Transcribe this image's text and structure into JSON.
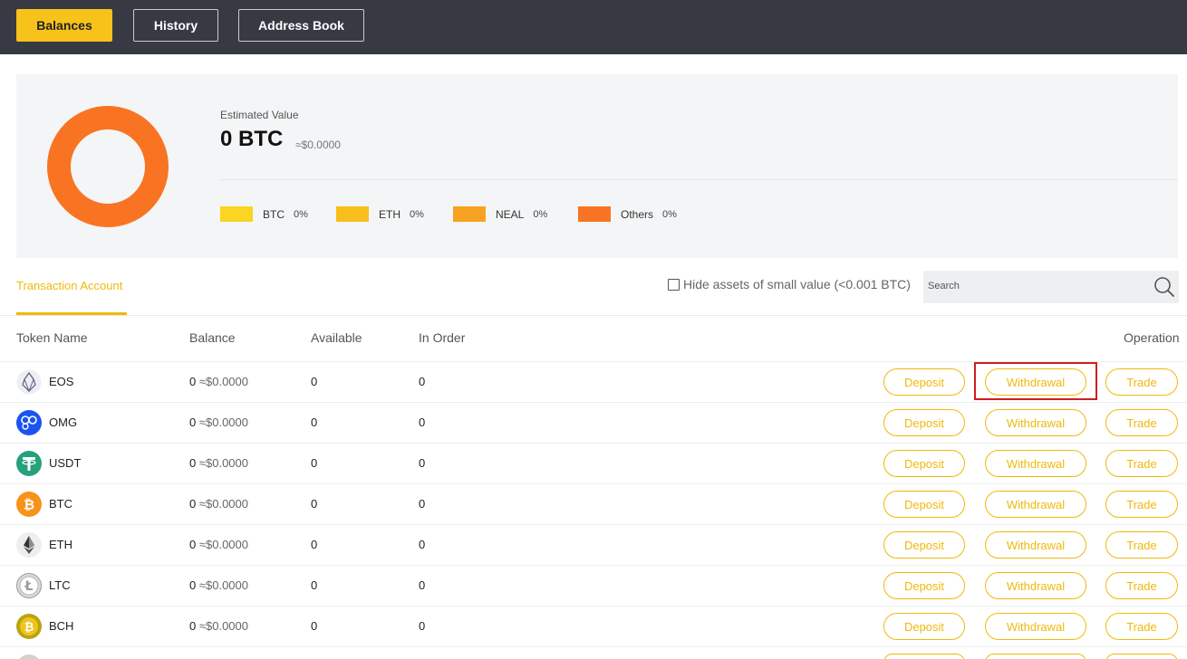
{
  "nav": {
    "balances": "Balances",
    "history": "History",
    "address_book": "Address Book"
  },
  "summary": {
    "estimated_label": "Estimated Value",
    "estimated_value": "0 BTC",
    "estimated_usd": "≈$0.0000",
    "legend": [
      {
        "name": "BTC",
        "pct": "0%",
        "color": "#fad521"
      },
      {
        "name": "ETH",
        "pct": "0%",
        "color": "#f8bf1c"
      },
      {
        "name": "NEAL",
        "pct": "0%",
        "color": "#f7a221"
      },
      {
        "name": "Others",
        "pct": "0%",
        "color": "#f87423"
      }
    ],
    "donut_color": "#f87423"
  },
  "tabs": {
    "active": "Transaction Account"
  },
  "filters": {
    "hide_small_label": "Hide assets of small value (<0.001 BTC)",
    "hide_small_checked": false,
    "search_placeholder": "Search"
  },
  "table": {
    "headers": {
      "token": "Token Name",
      "balance": "Balance",
      "available": "Available",
      "in_order": "In Order",
      "operation": "Operation"
    },
    "actions": {
      "deposit": "Deposit",
      "withdrawal": "Withdrawal",
      "trade": "Trade"
    },
    "rows": [
      {
        "token": "EOS",
        "balance": "0",
        "balance_usd": "≈$0.0000",
        "available": "0",
        "in_order": "0",
        "icon": "eos-icon"
      },
      {
        "token": "OMG",
        "balance": "0",
        "balance_usd": "≈$0.0000",
        "available": "0",
        "in_order": "0",
        "icon": "omg-icon"
      },
      {
        "token": "USDT",
        "balance": "0",
        "balance_usd": "≈$0.0000",
        "available": "0",
        "in_order": "0",
        "icon": "usdt-icon"
      },
      {
        "token": "BTC",
        "balance": "0",
        "balance_usd": "≈$0.0000",
        "available": "0",
        "in_order": "0",
        "icon": "btc-icon"
      },
      {
        "token": "ETH",
        "balance": "0",
        "balance_usd": "≈$0.0000",
        "available": "0",
        "in_order": "0",
        "icon": "eth-icon"
      },
      {
        "token": "LTC",
        "balance": "0",
        "balance_usd": "≈$0.0000",
        "available": "0",
        "in_order": "0",
        "icon": "ltc-icon"
      },
      {
        "token": "BCH",
        "balance": "0",
        "balance_usd": "≈$0.0000",
        "available": "0",
        "in_order": "0",
        "icon": "bch-icon"
      }
    ]
  },
  "colors": {
    "accent": "#f0b90b",
    "topbar": "#373a43",
    "highlight": "#cc1f1f"
  }
}
